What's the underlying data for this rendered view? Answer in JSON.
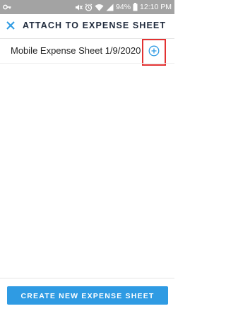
{
  "status_bar": {
    "battery_percent": "94%",
    "time": "12:10 PM",
    "icons": [
      "key-icon",
      "mute-icon",
      "alarm-icon",
      "wifi-icon",
      "signal-icon",
      "battery-icon"
    ]
  },
  "header": {
    "close_icon": "close-icon",
    "title": "ATTACH TO EXPENSE SHEET"
  },
  "list": {
    "items": [
      {
        "label": "Mobile Expense Sheet 1/9/2020",
        "action_icon": "add-circle-icon"
      }
    ]
  },
  "footer": {
    "create_button_label": "CREATE NEW EXPENSE SHEET"
  },
  "colors": {
    "status_bar": "#a3a3a3",
    "accent": "#2f9be3",
    "title_text": "#1f2a3c",
    "highlight": "#e23232"
  }
}
